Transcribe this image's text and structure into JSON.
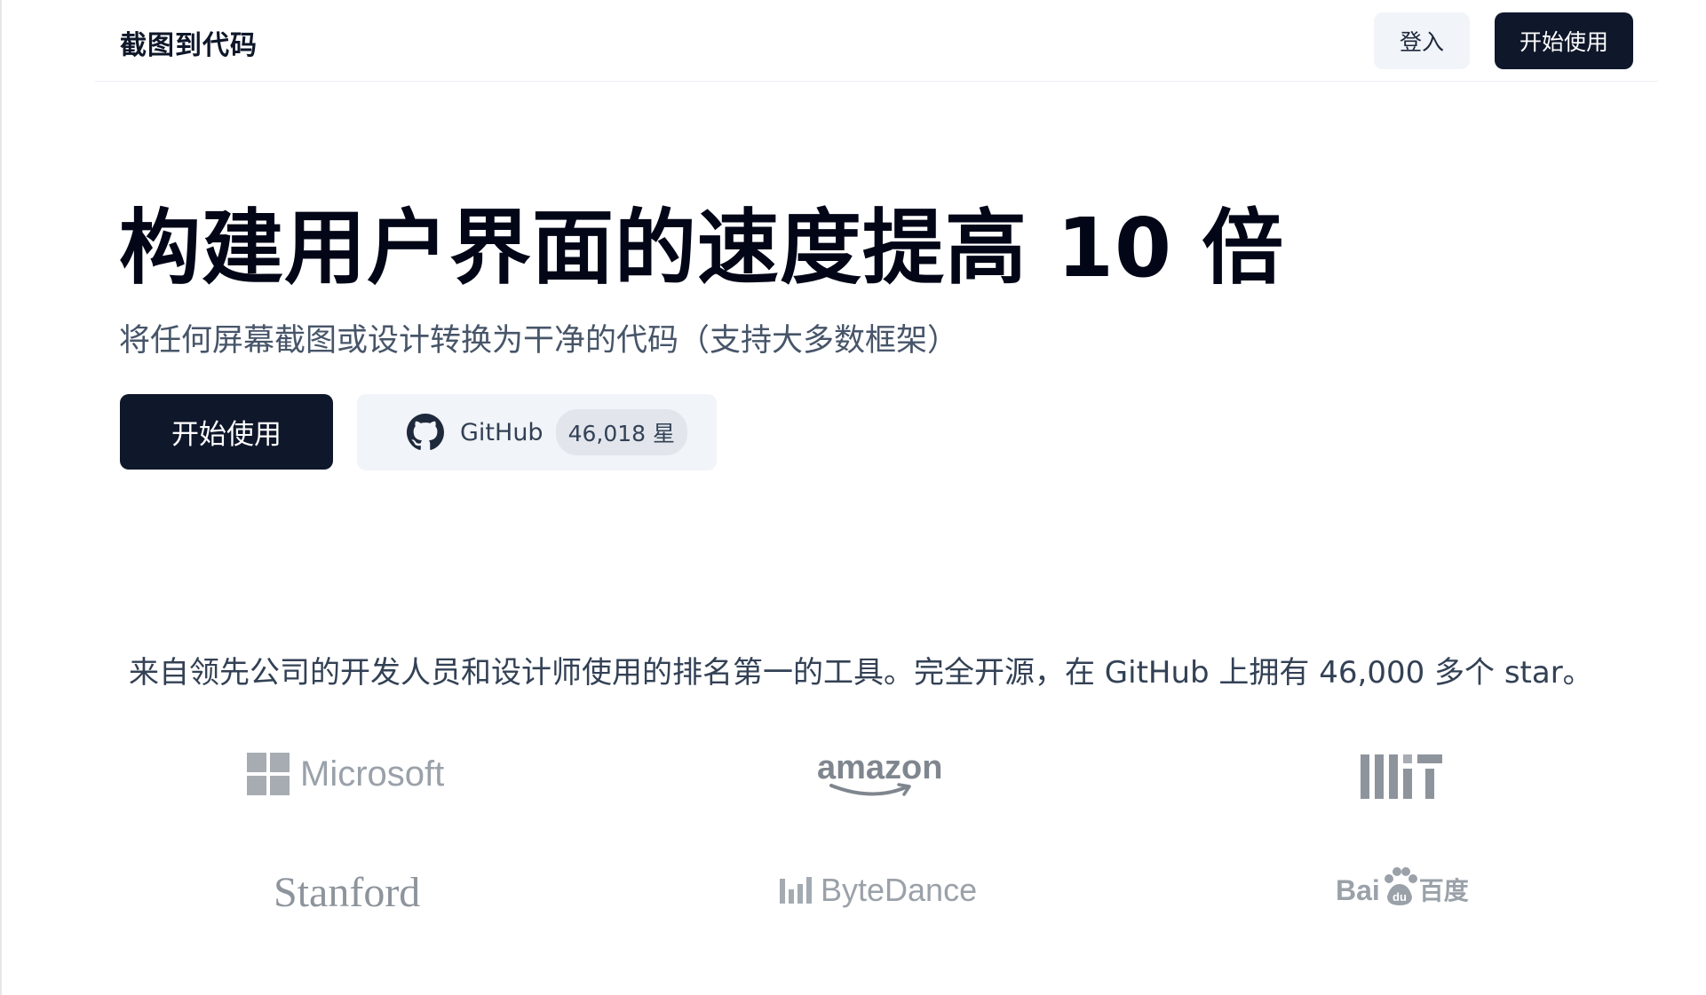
{
  "header": {
    "brand": "截图到代码",
    "login_label": "登入",
    "start_label": "开始使用"
  },
  "hero": {
    "title": "构建用户界面的速度提高 10 倍",
    "subtitle": "将任何屏幕截图或设计转换为干净的代码（支持大多数框架）",
    "start_label": "开始使用",
    "github_label": "GitHub",
    "github_stars": "46,018 星"
  },
  "trust": {
    "text": "来自领先公司的开发人员和设计师使用的排名第一的工具。完全开源，在 GitHub 上拥有 46,000 多个 star。",
    "logos": {
      "microsoft": "Microsoft",
      "amazon": "amazon",
      "mit": "MIT",
      "stanford": "Stanford",
      "bytedance": "ByteDance",
      "baidu_latin": "Bai",
      "baidu_cn": "百度"
    }
  },
  "colors": {
    "primary": "#0f172a",
    "secondary_bg": "#f1f4f8",
    "logo_gray": "#9aa1a9"
  }
}
